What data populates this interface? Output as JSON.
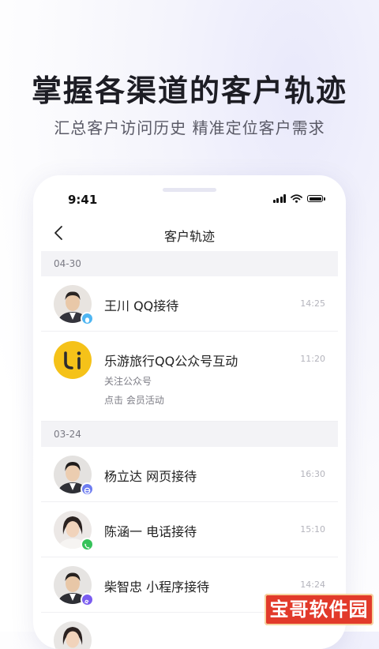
{
  "promo": {
    "headline": "掌握各渠道的客户轨迹",
    "subline": "汇总客户访问历史 精准定位客户需求"
  },
  "status_bar": {
    "time": "9:41"
  },
  "nav": {
    "title": "客户轨迹",
    "back_icon": "chevron-left-icon"
  },
  "sections": [
    {
      "date": "04-30",
      "items": [
        {
          "title": "王川 QQ接待",
          "time": "14:25",
          "badge": "qq-icon",
          "badge_color": "#4fb6f2"
        },
        {
          "title": "乐游旅行QQ公众号互动",
          "sub1": "关注公众号",
          "sub2": "点击 会员活动",
          "time": "11:20",
          "avatar_color": "#f5c219",
          "avatar_letter": "U"
        }
      ]
    },
    {
      "date": "03-24",
      "items": [
        {
          "title": "杨立达  网页接待",
          "time": "16:30",
          "badge": "web-icon",
          "badge_color": "#6d7cf0"
        },
        {
          "title": "陈涵一  电话接待",
          "time": "15:10",
          "badge": "phone-icon",
          "badge_color": "#36c25a"
        },
        {
          "title": "柴智忠  小程序接待",
          "time": "14:24",
          "badge": "mini-program-icon",
          "badge_color": "#7a5cf0"
        }
      ]
    }
  ],
  "watermark": "宝哥软件园",
  "colors": {
    "accent": "#6d7cf0",
    "qq": "#4fb6f2",
    "phone": "#36c25a",
    "brand_yellow": "#f5c219"
  }
}
